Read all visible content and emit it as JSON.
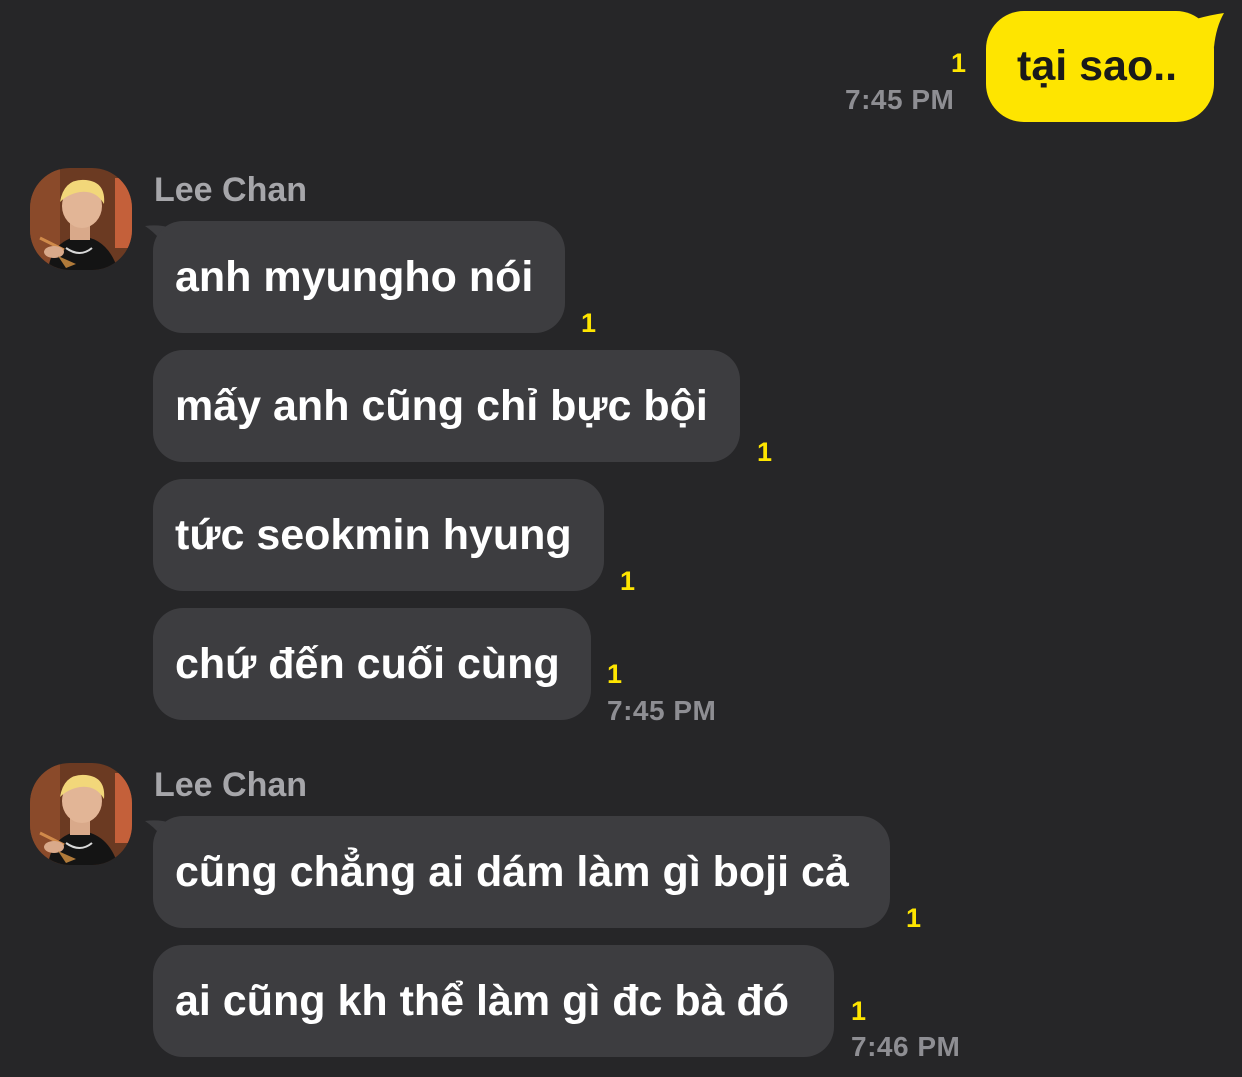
{
  "chat": {
    "outgoing": {
      "text": "tại sao..",
      "unread": "1",
      "time": "7:45 PM"
    },
    "group1": {
      "sender": "Lee Chan",
      "messages": [
        {
          "text": "anh myungho nói",
          "unread": "1"
        },
        {
          "text": "mấy anh cũng chỉ bực bội",
          "unread": "1"
        },
        {
          "text": "tức seokmin hyung",
          "unread": "1"
        },
        {
          "text": "chứ đến cuối cùng",
          "unread": "1"
        }
      ],
      "time": "7:45 PM"
    },
    "group2": {
      "sender": "Lee Chan",
      "messages": [
        {
          "text": "cũng chẳng ai dám làm gì boji cả",
          "unread": "1"
        },
        {
          "text": "ai cũng kh thể làm gì đc bà đó",
          "unread": "1"
        }
      ],
      "time": "7:46 PM"
    }
  },
  "colors": {
    "background": "#262628",
    "incoming_bubble": "#3d3d40",
    "outgoing_bubble": "#fee500",
    "unread": "#fee500",
    "time": "#8e8e93",
    "sender": "#a6a6aa"
  }
}
